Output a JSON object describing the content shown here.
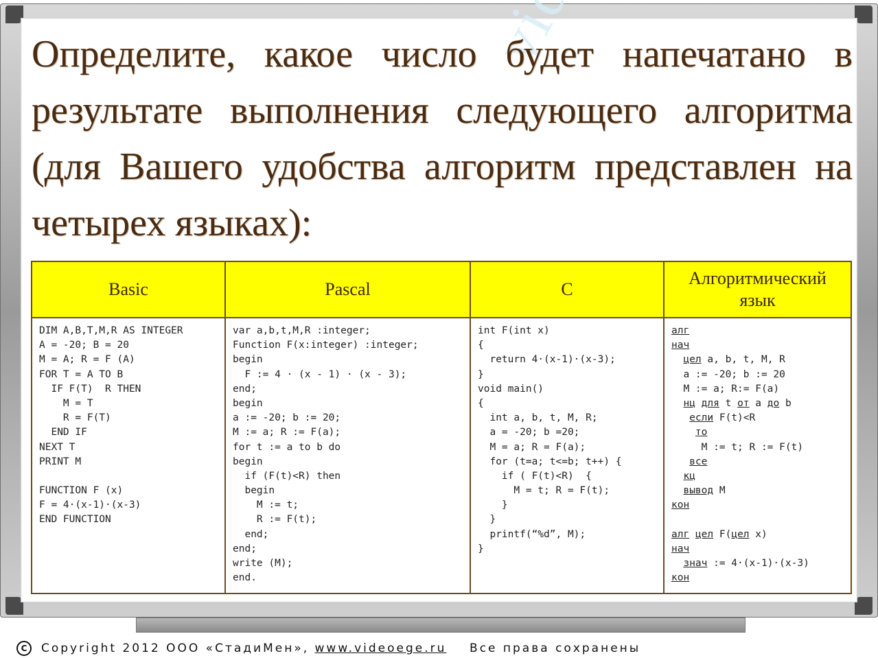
{
  "title": "Определите, какое число будет напечатано в результате выполнения следующего алгоритма (для Вашего удобства алгоритм представлен на четырех языках):",
  "watermark": "videoege.ru",
  "table": {
    "headers": [
      "Basic",
      "Pascal",
      "C",
      "Алгоритмический язык"
    ],
    "basic": [
      "DIM A,B,T,M,R AS INTEGER",
      "A = -20; B = 20",
      "M = A; R = F (A)",
      "FOR T = A TO B",
      "  IF F(T)  R THEN",
      "    M = T",
      "    R = F(T)",
      "  END IF",
      "NEXT T",
      "PRINT M",
      "",
      "FUNCTION F (x)",
      "F = 4·(x-1)·(x-3)",
      "END FUNCTION"
    ],
    "pascal": [
      "var a,b,t,M,R :integer;",
      "Function F(x:integer) :integer;",
      "begin",
      "  F := 4 · (x - 1) · (x - 3);",
      "end;",
      "begin",
      "a := -20; b := 20;",
      "M := a; R := F(a);",
      "for t := a to b do",
      "begin",
      "  if (F(t)<R) then",
      "  begin",
      "    M := t;",
      "    R := F(t);",
      "  end;",
      "end;",
      "write (M);",
      "end."
    ],
    "c": [
      "int F(int x)",
      "{",
      "  return 4·(x-1)·(x-3);",
      "}",
      "void main()",
      "{",
      "  int a, b, t, M, R;",
      "  a = -20; b =20;",
      "  M = a; R = F(a);",
      "  for (t=a; t<=b; t++) {",
      "    if ( F(t)<R)  {",
      "      M = t; R = F(t);",
      "    }",
      "  }",
      "  printf(“%d”, M);",
      "}"
    ],
    "alg": [
      [
        {
          "t": "алг",
          "u": true
        }
      ],
      [
        {
          "t": "нач",
          "u": true
        }
      ],
      [
        {
          "t": "  "
        },
        {
          "t": "цел",
          "u": true
        },
        {
          "t": " a, b, t, M, R"
        }
      ],
      [
        {
          "t": "  a := -20; b := 20"
        }
      ],
      [
        {
          "t": "  M := a; R:= F(a)"
        }
      ],
      [
        {
          "t": "  "
        },
        {
          "t": "нц",
          "u": true
        },
        {
          "t": " "
        },
        {
          "t": "для",
          "u": true
        },
        {
          "t": " t "
        },
        {
          "t": "от",
          "u": true
        },
        {
          "t": " a "
        },
        {
          "t": "до",
          "u": true
        },
        {
          "t": " b"
        }
      ],
      [
        {
          "t": "   "
        },
        {
          "t": "если",
          "u": true
        },
        {
          "t": " F(t)<R"
        }
      ],
      [
        {
          "t": "    "
        },
        {
          "t": "то",
          "u": true
        }
      ],
      [
        {
          "t": "     M := t; R := F(t)"
        }
      ],
      [
        {
          "t": "   "
        },
        {
          "t": "все",
          "u": true
        }
      ],
      [
        {
          "t": "  "
        },
        {
          "t": "кц",
          "u": true
        }
      ],
      [
        {
          "t": "  "
        },
        {
          "t": "вывод",
          "u": true
        },
        {
          "t": " M"
        }
      ],
      [
        {
          "t": "кон",
          "u": true
        }
      ],
      [
        {
          "t": ""
        }
      ],
      [
        {
          "t": "алг",
          "u": true
        },
        {
          "t": " "
        },
        {
          "t": "цел",
          "u": true
        },
        {
          "t": " F("
        },
        {
          "t": "цел",
          "u": true
        },
        {
          "t": " x)"
        }
      ],
      [
        {
          "t": "нач",
          "u": true
        }
      ],
      [
        {
          "t": "  "
        },
        {
          "t": "знач",
          "u": true
        },
        {
          "t": " := 4·(x-1)·(x-3)"
        }
      ],
      [
        {
          "t": "кон",
          "u": true
        }
      ]
    ]
  },
  "footer": {
    "copyright_sign": "С",
    "text": "Copyright 2012 ООО «СтадиМен»,",
    "link": "www.videoege.ru",
    "rights": "Все права сохранены"
  }
}
